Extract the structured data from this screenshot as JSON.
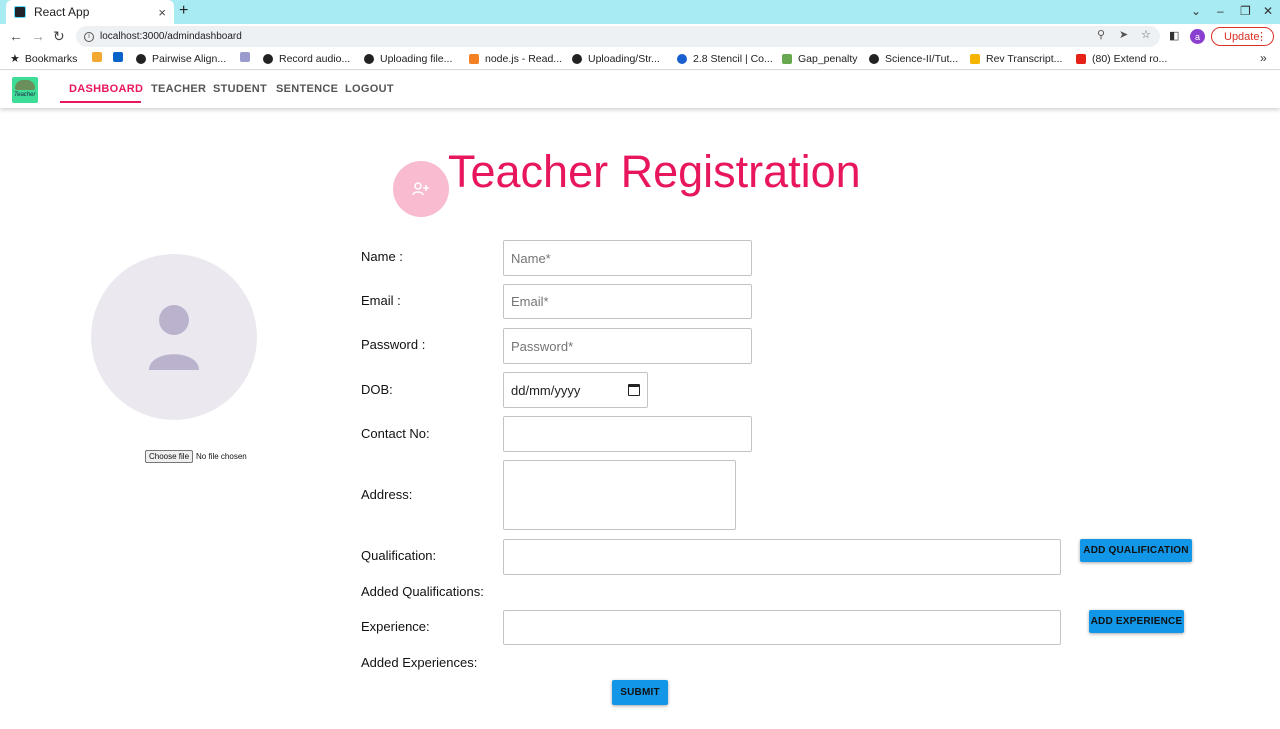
{
  "browser": {
    "tab_title": "React App",
    "tab_close": "×",
    "new_tab": "+",
    "url": "localhost:3000/admindashboard",
    "update_label": "Update",
    "profile_initial": "a"
  },
  "bookmarks": [
    {
      "label": "Bookmarks",
      "icon": "star-icon"
    },
    {
      "label": "",
      "icon": "bookmark-logo-icon"
    },
    {
      "label": "",
      "icon": "outlook-icon"
    },
    {
      "label": "Pairwise Align...",
      "icon": "github-icon"
    },
    {
      "label": "",
      "icon": "dna-icon"
    },
    {
      "label": "Record audio...",
      "icon": "github-icon"
    },
    {
      "label": "Uploading file...",
      "icon": "github-icon"
    },
    {
      "label": "node.js - Read...",
      "icon": "stackoverflow-icon"
    },
    {
      "label": "Uploading/Str...",
      "icon": "github-icon"
    },
    {
      "label": "2.8 Stencil | Co...",
      "icon": "c-icon"
    },
    {
      "label": "Gap_penalty",
      "icon": "tree-icon"
    },
    {
      "label": "Science-II/Tut...",
      "icon": "github-icon"
    },
    {
      "label": "Rev Transcript...",
      "icon": "folder-icon"
    },
    {
      "label": "(80) Extend ro...",
      "icon": "youtube-icon"
    }
  ],
  "navbar": {
    "logo_text": "Teacher",
    "items": [
      "DASHBOARD",
      "TEACHER",
      "STUDENT",
      "SENTENCE",
      "LOGOUT"
    ],
    "active": "DASHBOARD",
    "accent": "#e8175d"
  },
  "page": {
    "title": "Teacher Registration",
    "file_button": "Choose file",
    "file_status": "No file chosen"
  },
  "form": {
    "name_label": "Name :",
    "name_placeholder": "Name*",
    "email_label": "Email :",
    "email_placeholder": "Email*",
    "password_label": "Password :",
    "password_placeholder": "Password*",
    "dob_label": "DOB:",
    "dob_value": "dd/mm/yyyy",
    "contact_label": "Contact No:",
    "address_label": "Address:",
    "qualification_label": "Qualification:",
    "add_qualification": "ADD QUALIFICATION",
    "added_qualifications_label": "Added Qualifications:",
    "experience_label": "Experience:",
    "add_experience": "ADD EXPERIENCE",
    "added_experiences_label": "Added Experiences:",
    "submit": "SUBMIT",
    "button_color": "#1196e8"
  }
}
